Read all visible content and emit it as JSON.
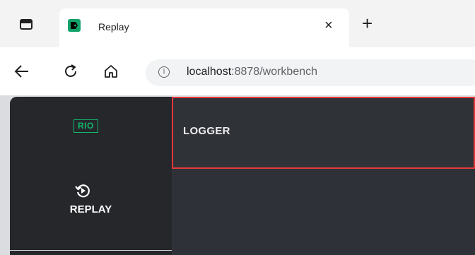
{
  "browser": {
    "tab_title": "Replay",
    "tab_close_glyph": "×",
    "new_tab_glyph": "+",
    "url_host": "localhost",
    "url_rest": ":8878/workbench",
    "icons": [
      "sidebar-toggle-icon",
      "favicon-icon",
      "close-icon",
      "plus-icon",
      "back-arrow-icon",
      "reload-icon",
      "home-icon",
      "info-icon"
    ]
  },
  "app": {
    "logo_text": "RIO",
    "nav": {
      "replay_label": "REPLAY",
      "replay_icon": "replay-icon"
    },
    "header": {
      "title": "LOGGER"
    },
    "colors": {
      "accent": "#12b76a",
      "highlight_border": "#e5383b",
      "sidebar_bg": "#25272b",
      "content_bg": "#2e3138"
    }
  }
}
